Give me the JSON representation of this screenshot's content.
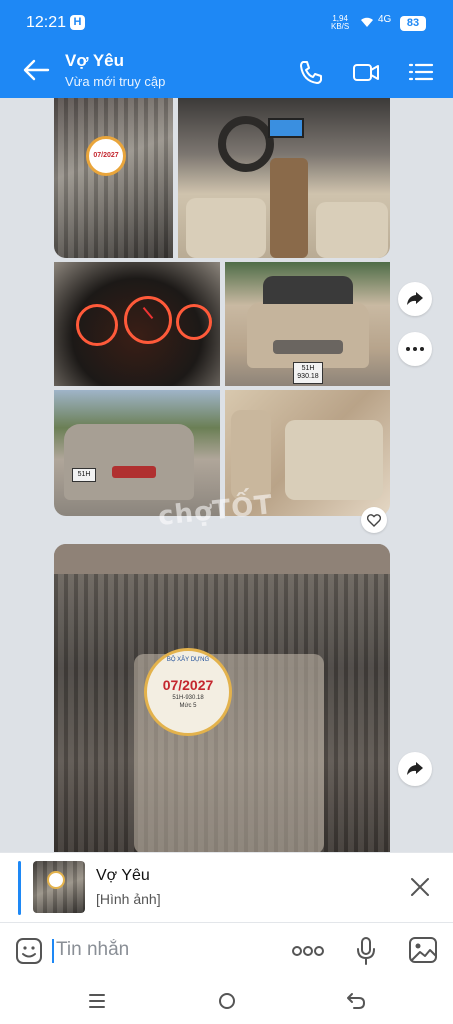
{
  "status": {
    "time": "12:21",
    "app_badge": "H",
    "net_speed": "1,94",
    "net_unit": "KB/S",
    "signal": "4G",
    "battery": "83"
  },
  "header": {
    "title": "Vợ Yêu",
    "subtitle": "Vừa mới truy cập"
  },
  "photos": {
    "sticker_small": "07/2027",
    "plate_front": "51H 930.18",
    "plate_rear": "51H",
    "sticker_large": {
      "top": "BỘ XÂY DỰNG",
      "code": "07/2027",
      "plate": "51H-930.18",
      "level": "Mức 5"
    },
    "watermark": "chợTỐT"
  },
  "reply_preview": {
    "name": "Vợ Yêu",
    "type": "[Hình ảnh]"
  },
  "composer": {
    "placeholder": "Tin nhắn"
  },
  "colors": {
    "accent": "#1e88f5",
    "chat_bg": "#dde1e6"
  },
  "icons": [
    "back-icon",
    "phone-icon",
    "video-icon",
    "list-icon",
    "share-icon",
    "more-icon",
    "heart-icon",
    "close-icon",
    "emoji-icon",
    "more-dots-icon",
    "mic-icon",
    "image-icon",
    "menu-nav-icon",
    "home-nav-icon",
    "back-nav-icon"
  ]
}
